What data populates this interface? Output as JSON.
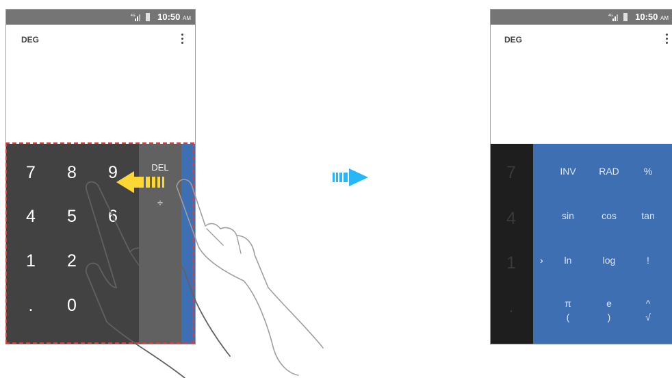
{
  "status_bar": {
    "network": "4G",
    "time": "10:50",
    "ampm": "AM"
  },
  "display": {
    "angle_mode": "DEG"
  },
  "keypad": {
    "digit_rows": [
      [
        "7",
        "8",
        "9"
      ],
      [
        "4",
        "5",
        "6"
      ],
      [
        "1",
        "2",
        ""
      ],
      [
        ".",
        "0",
        ""
      ]
    ],
    "operators": [
      "DEL",
      "÷"
    ]
  },
  "advanced_panel": {
    "rows": [
      [
        "INV",
        "RAD",
        "%"
      ],
      [
        "sin",
        "cos",
        "tan"
      ],
      [
        "ln",
        "log",
        "!"
      ],
      [
        "π",
        "e",
        "^"
      ],
      [
        "(",
        ")",
        "√"
      ]
    ],
    "dim_digits": [
      "7",
      "4",
      "1",
      "."
    ]
  },
  "icons": {
    "overflow_menu": "more-vert-icon",
    "swipe_arrow": "swipe-left-arrow-icon",
    "flow_arrow": "next-step-arrow-icon",
    "hand": "hand-gesture-icon"
  },
  "colors": {
    "status_bar": "#757575",
    "keypad": "#424242",
    "operator_column": "#616161",
    "advanced_panel": "#3f6fb3",
    "swipe_arrow": "#fdd835",
    "flow_arrow": "#29b6f6",
    "dashed_frame": "#e53935"
  }
}
